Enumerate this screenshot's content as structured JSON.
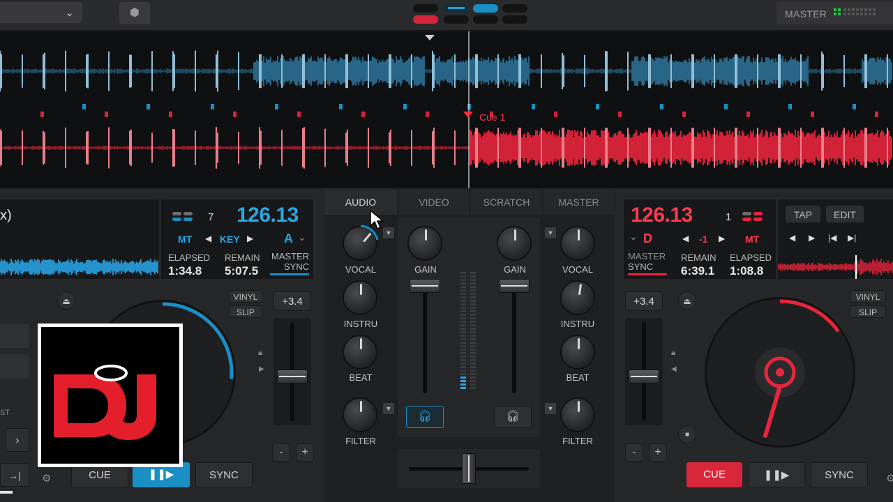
{
  "top_bar": {
    "master_label": "MASTER",
    "cube_icon": "cube-icon",
    "dropdown_icon": "chevron-down-icon"
  },
  "waveform": {
    "cue_label": "Cue 1"
  },
  "left_deck": {
    "title_fragment": "x)",
    "bpm": "126.13",
    "sync_count": "7",
    "mt": "MT",
    "key_label": "KEY",
    "key_value": "A",
    "elapsed_label": "ELAPSED",
    "elapsed": "1:34.8",
    "remain_label": "REMAIN",
    "remain": "5:07.5",
    "master_label": "MASTER",
    "sync_label": "SYNC",
    "pitch": "+3.4",
    "vinyl": "VINYL",
    "slip": "SLIP",
    "minus": "-",
    "plus": "+",
    "cue": "CUE",
    "play": "❚❚▶",
    "sync": "SYNC",
    "st_fragment": "ST"
  },
  "right_deck": {
    "bpm": "126.13",
    "sync_count": "1",
    "key_value": "D",
    "key_offset": "-1",
    "mt": "MT",
    "tap": "TAP",
    "edit": "EDIT",
    "master_label": "MASTER",
    "sync_label": "SYNC",
    "remain_label": "REMAIN",
    "remain": "6:39.1",
    "elapsed_label": "ELAPSED",
    "elapsed": "1:08.8",
    "pitch": "+3.4",
    "vinyl": "VINYL",
    "slip": "SLIP",
    "minus": "-",
    "plus": "+",
    "cue": "CUE",
    "play": "❚❚▶",
    "sync": "SYNC"
  },
  "mixer": {
    "tabs": [
      "AUDIO",
      "VIDEO",
      "SCRATCH",
      "MASTER"
    ],
    "active_tab": "AUDIO",
    "left_knobs": [
      "VOCAL",
      "INSTRU",
      "BEAT",
      "FILTER"
    ],
    "right_knobs": [
      "VOCAL",
      "INSTRU",
      "BEAT",
      "FILTER"
    ],
    "gain_left": "GAIN",
    "gain_right": "GAIN"
  },
  "logo": {
    "text": "DJ"
  },
  "colors": {
    "deck_left": "#1a8fc6",
    "deck_right": "#e8253d",
    "active_play": "#1a8fc6",
    "cue_right": "#d8263a"
  }
}
